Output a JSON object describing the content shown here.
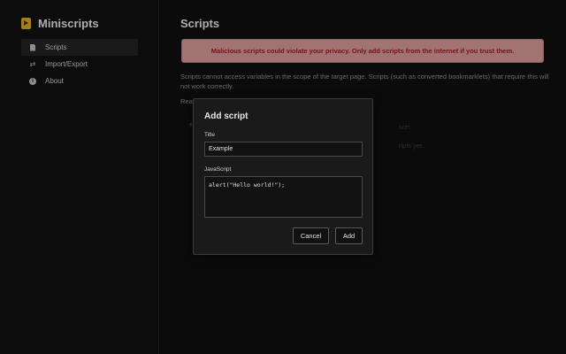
{
  "app": {
    "name": "Miniscripts"
  },
  "sidebar": {
    "items": [
      {
        "label": "Scripts",
        "icon": "document-icon",
        "active": true
      },
      {
        "label": "Import/Export",
        "icon": "swap-arrows-icon",
        "active": false
      },
      {
        "label": "About",
        "icon": "info-icon",
        "active": false
      }
    ]
  },
  "main": {
    "title": "Scripts",
    "warning": "Malicious scripts could violate your privacy. Only add scripts from the internet if you trust them.",
    "description": "Scripts cannot access variables in the scope of the target page. Scripts (such as converted bookmarklets) that require this will not work correctly.",
    "read_more": "Rea",
    "bg_sort": "sort",
    "bg_empty": "ripts yet."
  },
  "dialog": {
    "title": "Add script",
    "title_label": "Title",
    "title_value": "Example",
    "js_label": "JavaScript",
    "js_value": "alert(\"Hello world!\");",
    "cancel_label": "Cancel",
    "add_label": "Add"
  },
  "colors": {
    "brand": "#d8a82a",
    "warning_bg": "#d99a9a",
    "warning_text": "#9a1b1b"
  }
}
